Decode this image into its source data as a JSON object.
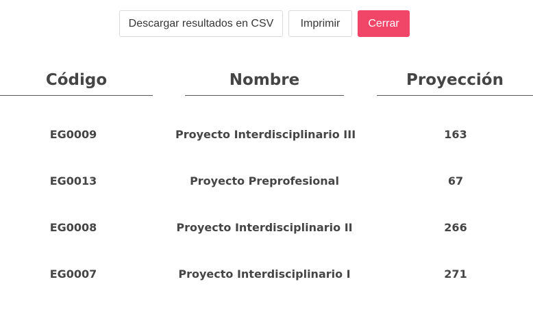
{
  "toolbar": {
    "csv_label": "Descargar resultados en CSV",
    "print_label": "Imprimir",
    "close_label": "Cerrar",
    "close_color": "#f14668"
  },
  "table": {
    "headers": {
      "code": "Código",
      "name": "Nombre",
      "projection": "Proyección"
    },
    "rows": [
      {
        "code": "EG0009",
        "name": "Proyecto Interdisciplinario III",
        "projection": "163"
      },
      {
        "code": "EG0013",
        "name": "Proyecto Preprofesional",
        "projection": "67"
      },
      {
        "code": "EG0008",
        "name": "Proyecto Interdisciplinario II",
        "projection": "266"
      },
      {
        "code": "EG0007",
        "name": "Proyecto Interdisciplinario I",
        "projection": "271"
      }
    ]
  }
}
